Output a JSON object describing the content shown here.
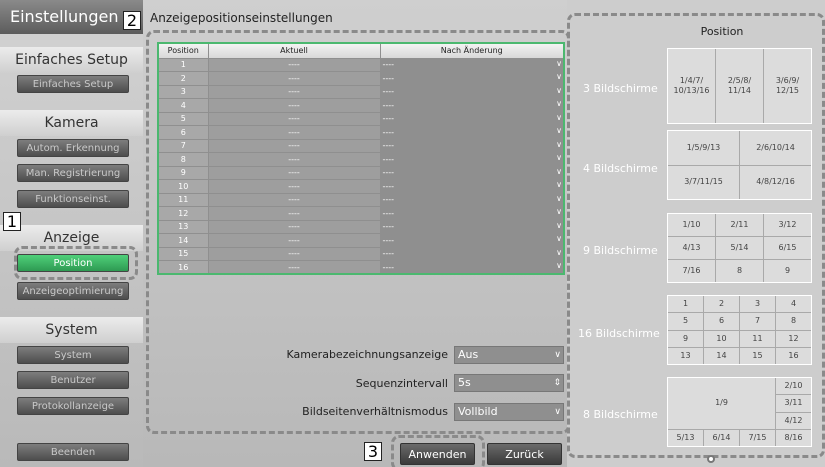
{
  "sidebar": {
    "header": "Einstellungen",
    "sections": [
      {
        "title": "Einfaches Setup",
        "items": [
          "Einfaches Setup"
        ]
      },
      {
        "title": "Kamera",
        "items": [
          "Autom. Erkennung",
          "Man. Registrierung",
          "Funktionseinst."
        ]
      },
      {
        "title": "Anzeige",
        "items": [
          "Position",
          "Anzeigeoptimierung"
        ]
      },
      {
        "title": "System",
        "items": [
          "System",
          "Benutzer",
          "Protokollanzeige"
        ]
      }
    ],
    "exit": "Beenden"
  },
  "main": {
    "title": "Anzeigepositionseinstellungen",
    "table": {
      "headers": [
        "Position",
        "Aktuell",
        "Nach Änderung"
      ],
      "rows": [
        {
          "pos": "1",
          "current": "----",
          "after": "----"
        },
        {
          "pos": "2",
          "current": "----",
          "after": "----"
        },
        {
          "pos": "3",
          "current": "----",
          "after": "----"
        },
        {
          "pos": "4",
          "current": "----",
          "after": "----"
        },
        {
          "pos": "5",
          "current": "----",
          "after": "----"
        },
        {
          "pos": "6",
          "current": "----",
          "after": "----"
        },
        {
          "pos": "7",
          "current": "----",
          "after": "----"
        },
        {
          "pos": "8",
          "current": "----",
          "after": "----"
        },
        {
          "pos": "9",
          "current": "----",
          "after": "----"
        },
        {
          "pos": "10",
          "current": "----",
          "after": "----"
        },
        {
          "pos": "11",
          "current": "----",
          "after": "----"
        },
        {
          "pos": "12",
          "current": "----",
          "after": "----"
        },
        {
          "pos": "13",
          "current": "----",
          "after": "----"
        },
        {
          "pos": "14",
          "current": "----",
          "after": "----"
        },
        {
          "pos": "15",
          "current": "----",
          "after": "----"
        },
        {
          "pos": "16",
          "current": "----",
          "after": "----"
        }
      ]
    },
    "settings": {
      "camera_label": {
        "label": "Kamerabezeichnungsanzeige",
        "value": "Aus"
      },
      "sequence": {
        "label": "Sequenzintervall",
        "value": "5s"
      },
      "aspect": {
        "label": "Bildseitenverhältnismodus",
        "value": "Vollbild"
      }
    },
    "apply": "Anwenden",
    "back": "Zurück"
  },
  "callouts": [
    "1",
    "2",
    "3"
  ],
  "layouts": {
    "title": "Position",
    "screens3": {
      "label": "3 Bildschirme",
      "cells": [
        "1/4/7/ 10/13/16",
        "2/5/8/ 11/14",
        "3/6/9/ 12/15"
      ]
    },
    "screens4": {
      "label": "4 Bildschirme",
      "cells": [
        "1/5/9/13",
        "2/6/10/14",
        "3/7/11/15",
        "4/8/12/16"
      ]
    },
    "screens9": {
      "label": "9 Bildschirme",
      "cells": [
        "1/10",
        "2/11",
        "3/12",
        "4/13",
        "5/14",
        "6/15",
        "7/16",
        "8",
        "9"
      ]
    },
    "screens16": {
      "label": "16 Bildschirme",
      "cells": [
        "1",
        "2",
        "3",
        "4",
        "5",
        "6",
        "7",
        "8",
        "9",
        "10",
        "11",
        "12",
        "13",
        "14",
        "15",
        "16"
      ]
    },
    "screens8": {
      "label": "8 Bildschirme",
      "big": "1/9",
      "right": [
        "2/10",
        "3/11",
        "4/12"
      ],
      "bottom": [
        "5/13",
        "6/14",
        "7/15",
        "8/16"
      ]
    }
  }
}
